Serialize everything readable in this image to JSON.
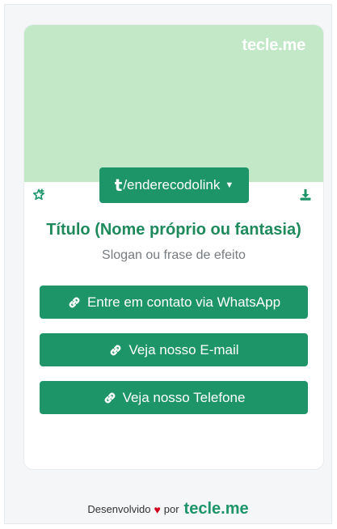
{
  "cover": {
    "brand": "tecle.me",
    "color": "#c3e8c8"
  },
  "profile": {
    "handle": "/enderecodolink",
    "handle_logo": "t",
    "title": "Título (Nome próprio ou fantasia)",
    "slogan": "Slogan ou frase de efeito"
  },
  "icons": {
    "favorite": "star-plus-icon",
    "download": "download-icon",
    "link": "link-icon",
    "caret": "caret-down-icon"
  },
  "links": [
    {
      "label": "Entre em contato via WhatsApp"
    },
    {
      "label": "Veja nosso E-mail"
    },
    {
      "label": "Veja nosso Telefone"
    }
  ],
  "footer": {
    "developed": "Desenvolvido",
    "by": "por",
    "brand": "tecle.me"
  },
  "colors": {
    "accent": "#1e9469",
    "title": "#1e8a5c",
    "heart": "#d0021b"
  }
}
